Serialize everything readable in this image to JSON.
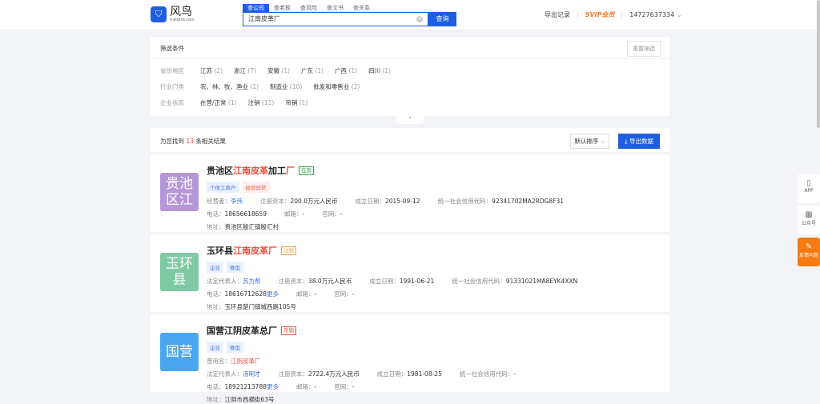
{
  "header": {
    "logo_name": "风鸟",
    "logo_url": "riskbird.com",
    "search_tabs": [
      "查公司",
      "查老板",
      "查风险",
      "查文书",
      "查关系"
    ],
    "search_value": "江南皮革厂",
    "search_button": "查询",
    "export_records": "导出记录",
    "svip": "SVIP会员",
    "account": "14727637334"
  },
  "filters": {
    "title": "筛选条件",
    "reset": "重置筛选",
    "rows": [
      {
        "label": "省份地区",
        "options": [
          {
            "name": "江苏",
            "count": "(2)"
          },
          {
            "name": "浙江",
            "count": "(7)"
          },
          {
            "name": "安徽",
            "count": "(1)"
          },
          {
            "name": "广东",
            "count": "(1)"
          },
          {
            "name": "广西",
            "count": "(1)"
          },
          {
            "name": "四川",
            "count": "(1)"
          }
        ]
      },
      {
        "label": "行业门类",
        "options": [
          {
            "name": "农、林、牧、渔业",
            "count": "(1)"
          },
          {
            "name": "制造业",
            "count": "(10)"
          },
          {
            "name": "批发和零售业",
            "count": "(2)"
          }
        ]
      },
      {
        "label": "企业状态",
        "options": [
          {
            "name": "在营/正常",
            "count": "(1)"
          },
          {
            "name": "注销",
            "count": "(11)"
          },
          {
            "name": "吊销",
            "count": "(1)"
          }
        ]
      }
    ]
  },
  "results": {
    "prefix": "为您找到",
    "count": "13",
    "suffix": "条相关结果",
    "sort": "默认排序",
    "export": "导出数据"
  },
  "companies": [
    {
      "avatar": "贵池区江",
      "avatar_color": "#b597d8",
      "title_parts": [
        {
          "t": "贵池区",
          "hl": false
        },
        {
          "t": "江南皮革",
          "hl": true
        },
        {
          "t": "加工",
          "hl": false
        },
        {
          "t": "厂",
          "hl": true
        }
      ],
      "status": "在营",
      "status_color": "#2aa84a",
      "tags": [
        {
          "t": "个体工商户",
          "red": false
        },
        {
          "t": "经营异常",
          "red": true
        }
      ],
      "lines": [
        [
          {
            "k": "经营者：",
            "v": "李伟",
            "c": "blue"
          },
          {
            "k": "注册资本：",
            "v": "200.0万元人民币"
          },
          {
            "k": "成立日期：",
            "v": "2015-09-12"
          },
          {
            "k": "统一社会信用代码：",
            "v": "92341702MA2RDG8F31"
          }
        ],
        [
          {
            "k": "电话：",
            "v": "18656618659"
          },
          {
            "k": "邮箱：",
            "v": "-"
          },
          {
            "k": "官网：",
            "v": "-"
          }
        ],
        [
          {
            "k": "地址：",
            "v": "贵池区殷汇镇殷汇村"
          }
        ]
      ]
    },
    {
      "avatar": "玉环县",
      "avatar_color": "#7ec9a4",
      "title_parts": [
        {
          "t": "玉环县",
          "hl": false
        },
        {
          "t": "江南皮革厂",
          "hl": true
        }
      ],
      "status": "注销",
      "status_color": "#f0a030",
      "tags": [
        {
          "t": "企业",
          "red": false
        },
        {
          "t": "微型",
          "red": false
        }
      ],
      "lines": [
        [
          {
            "k": "法定代表人：",
            "v": "苏为帮",
            "c": "blue"
          },
          {
            "k": "注册资本：",
            "v": "38.0万元人民币"
          },
          {
            "k": "成立日期：",
            "v": "1991-06-21"
          },
          {
            "k": "统一社会信用代码：",
            "v": "91331021MA8EYK4XXN"
          }
        ],
        [
          {
            "k": "电话：",
            "v": "18616712628",
            "more": "更多"
          },
          {
            "k": "邮箱：",
            "v": "-"
          },
          {
            "k": "官网：",
            "v": "-"
          }
        ],
        [
          {
            "k": "地址：",
            "v": "玉环县楚门镇城西路105号"
          }
        ]
      ]
    },
    {
      "avatar": "国营",
      "avatar_color": "#4aa6f0",
      "title_parts": [
        {
          "t": "国营江阴皮革总厂",
          "hl": false
        }
      ],
      "status": "吊销",
      "status_color": "#f04a3a",
      "tags": [
        {
          "t": "企业",
          "red": false
        },
        {
          "t": "微型",
          "red": false
        }
      ],
      "lines": [
        [
          {
            "k": "曾用名：",
            "v": "江阴皮革厂",
            "c": "red"
          }
        ],
        [
          {
            "k": "法定代表人：",
            "v": "汤明才",
            "c": "blue"
          },
          {
            "k": "注册资本：",
            "v": "2722.4万元人民币"
          },
          {
            "k": "成立日期：",
            "v": "1981-08-25"
          },
          {
            "k": "统一社会信用代码：",
            "v": "-"
          }
        ],
        [
          {
            "k": "电话：",
            "v": "18921213788",
            "more": "更多"
          },
          {
            "k": "邮箱：",
            "v": "-"
          },
          {
            "k": "官网：",
            "v": "-"
          }
        ],
        [
          {
            "k": "地址：",
            "v": "江阴市西横街63号"
          }
        ]
      ]
    }
  ],
  "side": {
    "app": "APP",
    "wechat": "公众号",
    "feedback": "反馈问题"
  }
}
